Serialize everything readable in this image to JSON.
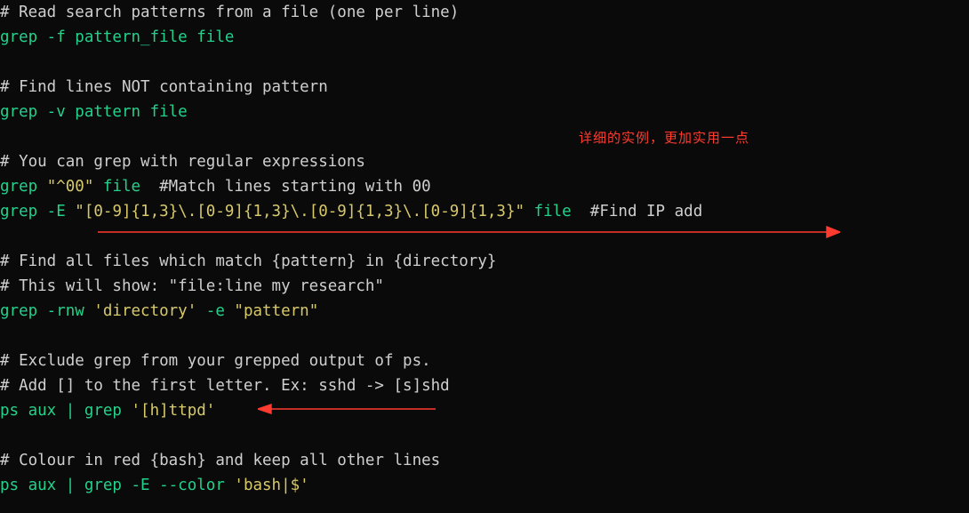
{
  "colors": {
    "bg": "#0a0a0a",
    "comment": "#cfcfcf",
    "command": "#23d18b",
    "string": "#d7c96b",
    "annotation": "#ff3b30"
  },
  "annotations": {
    "red_text": "详细的实例，更加实用一点"
  },
  "lines": {
    "c1": "# Read search patterns from a file (one per line)",
    "l1a": "grep -f pattern_file file",
    "c2": "# Find lines NOT containing pattern",
    "l2a": "grep -v pattern file",
    "c3": "# You can grep with regular expressions",
    "l3a": "grep ",
    "l3a_str": "\"^00\"",
    "l3a_rest": " file  ",
    "l3a_cmt": "#Match lines starting with 00",
    "l3b": "grep -E ",
    "l3b_str": "\"[0-9]{1,3}\\.[0-9]{1,3}\\.[0-9]{1,3}\\.[0-9]{1,3}\"",
    "l3b_rest": " file  ",
    "l3b_cmt": "#Find IP add",
    "c4": "# Find all files which match {pattern} in {directory}",
    "c5": "# This will show: \"file:line my research\"",
    "l4a": "grep -rnw ",
    "l4a_str1": "'directory'",
    "l4a_mid": " -e ",
    "l4a_str2": "\"pattern\"",
    "c6": "# Exclude grep from your grepped output of ps.",
    "c7": "# Add [] to the first letter. Ex: sshd -> [s]shd",
    "l5a": "ps aux | grep ",
    "l5a_str": "'[h]ttpd'",
    "c8": "# Colour in red {bash} and keep all other lines",
    "l6a": "ps aux | grep -E --color ",
    "l6a_str": "'bash|$'"
  }
}
